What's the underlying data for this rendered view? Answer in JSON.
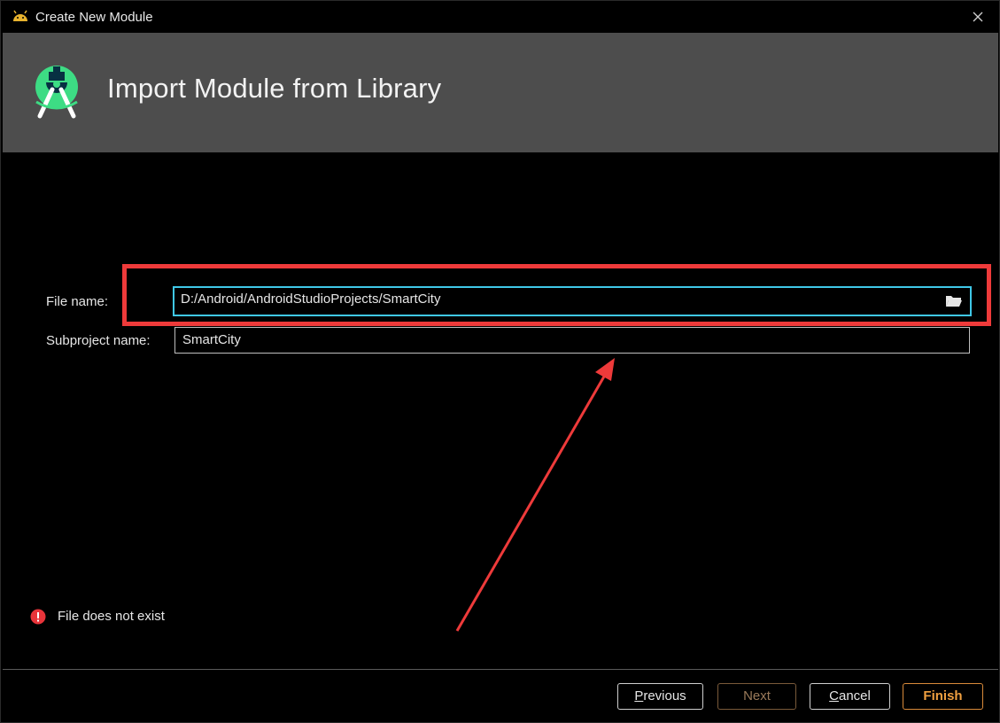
{
  "window": {
    "title": "Create New Module",
    "app_icon": "android-icon",
    "close_icon": "close-icon"
  },
  "header": {
    "heading": "Import Module from Library",
    "logo": "android-studio-icon"
  },
  "form": {
    "file_name_label": "File name:",
    "file_name_value": "D:/Android/AndroidStudioProjects/SmartCity",
    "browse_icon": "folder-open-icon",
    "subproject_label": "Subproject name:",
    "subproject_value": "SmartCity"
  },
  "validation": {
    "icon": "error-icon",
    "message": "File does not exist"
  },
  "buttons": {
    "previous_mnemonic": "P",
    "previous_rest": "revious",
    "next": "Next",
    "cancel_mnemonic": "C",
    "cancel_rest": "ancel",
    "finish": "Finish"
  },
  "colors": {
    "header_bg": "#4d4d4d",
    "focus_border": "#3fc8e8",
    "annotation_red": "#ee3a3a",
    "finish_accent": "#f0a040",
    "error_red": "#e8343a"
  }
}
